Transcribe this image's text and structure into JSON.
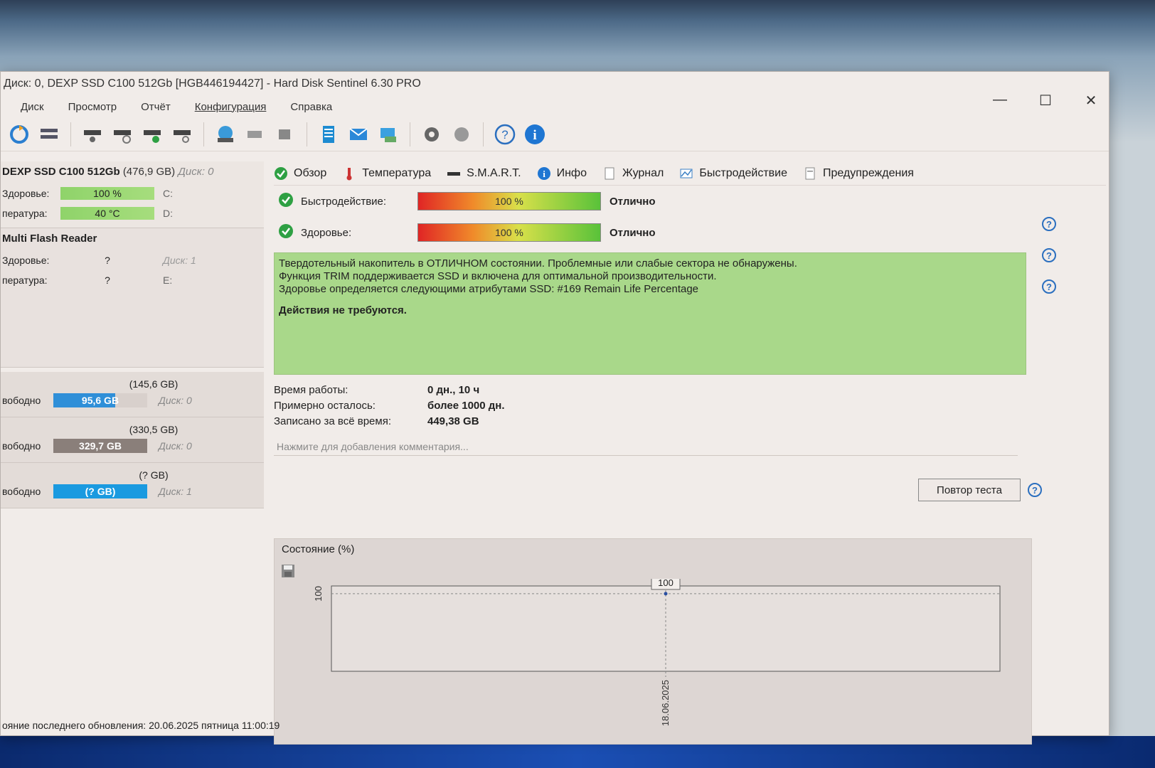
{
  "window": {
    "title": "Диск: 0, DEXP SSD C100 512Gb [HGB446194427]  -  Hard Disk Sentinel 6.30 PRO"
  },
  "menu": [
    "Диск",
    "Просмотр",
    "Отчёт",
    "Конфигурация",
    "Справка"
  ],
  "disks": [
    {
      "name": "DEXP SSD C100 512Gb",
      "size": "(476,9 GB)",
      "num": "Диск: 0",
      "health_label": "Здоровье:",
      "health": "100 %",
      "temp_label": "пература:",
      "temp": "40 °C",
      "drive1": "C:",
      "drive2": "D:"
    },
    {
      "name": "Multi  Flash Reader",
      "health_label": "Здоровье:",
      "health": "?",
      "temp_label": "пература:",
      "temp": "?",
      "num": "Диск: 1",
      "drive1": "E:"
    }
  ],
  "partitions": [
    {
      "size": "(145,6 GB)",
      "free_label": "вободно",
      "free": "95,6 GB",
      "disk": "Диск: 0",
      "color": "#2f8fd8",
      "fill": 0.66
    },
    {
      "size": "(330,5 GB)",
      "free_label": "вободно",
      "free": "329,7 GB",
      "disk": "Диск: 0",
      "color": "#8a7f7a",
      "fill": 1.0
    },
    {
      "size": "(? GB)",
      "free_label": "вободно",
      "free": "(? GB)",
      "disk": "Диск: 1",
      "color": "#1a9ae0",
      "fill": 1.0
    }
  ],
  "tabs": [
    "Обзор",
    "Температура",
    "S.M.A.R.T.",
    "Инфо",
    "Журнал",
    "Быстродействие",
    "Предупреждения"
  ],
  "performance": {
    "label": "Быстродействие:",
    "value": "100 %",
    "status": "Отлично"
  },
  "health": {
    "label": "Здоровье:",
    "value": "100 %",
    "status": "Отлично"
  },
  "info_lines": [
    "Твердотельный накопитель в ОТЛИЧНОМ состоянии. Проблемные или слабые сектора не обнаружены.",
    "Функция TRIM поддерживается SSD и включена для оптимальной производительности.",
    "Здоровье определяется следующими атрибутами SSD: #169 Remain Life Percentage"
  ],
  "info_action": "Действия не требуются.",
  "stats": [
    {
      "k": "Время работы:",
      "v": "0 дн., 10 ч"
    },
    {
      "k": "Примерно осталось:",
      "v": "более 1000 дн."
    },
    {
      "k": "Записано за всё время:",
      "v": "449,38 GB"
    }
  ],
  "retest_label": "Повтор теста",
  "comment_placeholder": "Нажмите для добавления комментария...",
  "chart_data": {
    "type": "line",
    "title": "Состояние (%)",
    "x": [
      "18.06.2025"
    ],
    "series": [
      {
        "values": [
          100
        ]
      }
    ],
    "yticks": [
      "100"
    ],
    "data_labels": [
      "100"
    ]
  },
  "statusbar": "ояние последнего обновления: 20.06.2025 пятница 11:00:19"
}
